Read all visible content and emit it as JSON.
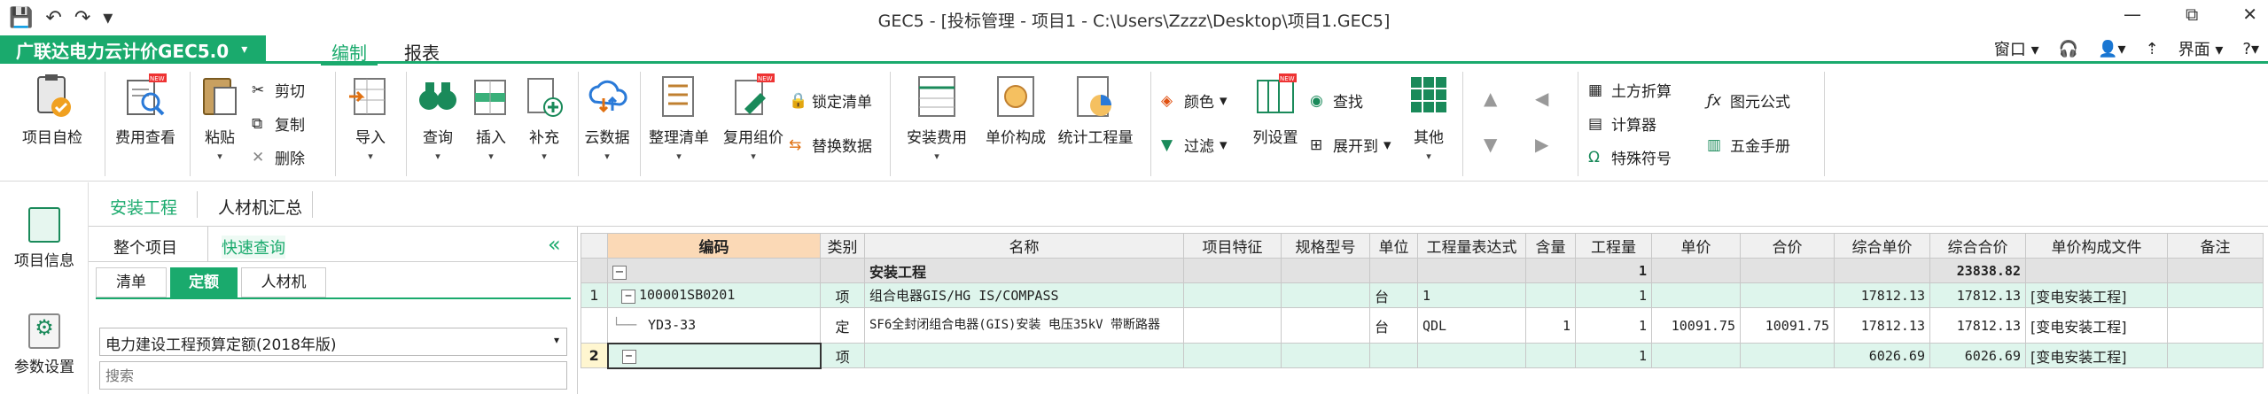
{
  "window": {
    "title": "GEC5 - [投标管理 - 项目1 - C:\\Users\\Zzzz\\Desktop\\项目1.GEC5]",
    "controls": [
      "—",
      "⧉",
      "✕"
    ]
  },
  "quick_access": {
    "save": "💾",
    "undo": "↶",
    "redo": "↷",
    "more": "▾"
  },
  "brand": {
    "label": "广联达电力云计价GEC5.0",
    "caret": "▾"
  },
  "menu_tabs": {
    "edit": "编制",
    "report": "报表"
  },
  "right_menu": {
    "window": "窗口",
    "window_caret": "▾",
    "interface": "界面",
    "interface_caret": "▾"
  },
  "ribbon": {
    "project_check": "项目自检",
    "fee_view": "费用查看",
    "paste": "粘贴",
    "cut": "剪切",
    "copy": "复制",
    "delete": "删除",
    "import": "导入",
    "query": "查询",
    "insert": "插入",
    "supplement": "补充",
    "cloud_data": "云数据",
    "organize_list": "整理清单",
    "reuse_price": "复用组价",
    "lock_list": "锁定清单",
    "replace_data": "替换数据",
    "install_fee": "安装费用",
    "unit_compose": "单价构成",
    "stat_qty": "统计工程量",
    "color": "颜色",
    "filter": "过滤",
    "col_settings": "列设置",
    "find": "查找",
    "expand_to": "展开到",
    "other": "其他",
    "earthwork": "土方折算",
    "calculator": "计算器",
    "special_symbol": "特殊符号",
    "element_formula": "图元公式",
    "hardware_manual": "五金手册",
    "new_badge": "NEW"
  },
  "left_nav": {
    "project_info": "项目信息",
    "param_settings": "参数设置"
  },
  "tabs2": {
    "install": "安装工程",
    "labor_summary": "人材机汇总"
  },
  "panel": {
    "whole_project": "整个项目",
    "quick_query": "快速查询",
    "subtabs": {
      "list": "清单",
      "quota": "定额",
      "labor": "人材机"
    },
    "quota_select": "电力建设工程预算定额(2018年版)",
    "search_placeholder": "搜索",
    "collapse": "«"
  },
  "table": {
    "headers": [
      "编码",
      "类别",
      "名称",
      "项目特征",
      "规格型号",
      "单位",
      "工程量表达式",
      "含量",
      "工程量",
      "单价",
      "合价",
      "综合单价",
      "综合合价",
      "单价构成文件",
      "备注"
    ],
    "rows": [
      {
        "idx": "",
        "toggle": "−",
        "code": "",
        "type": "",
        "name": "安装工程",
        "feature": "",
        "spec": "",
        "unit": "",
        "expr": "",
        "content": "",
        "qty": "1",
        "price": "",
        "total": "",
        "comp_price": "",
        "comp_total": "23838.82",
        "file": "",
        "note": ""
      },
      {
        "idx": "1",
        "toggle": "−",
        "code": "100001SB0201",
        "type": "项",
        "name": "组合电器GIS/HG IS/COMPASS",
        "feature": "",
        "spec": "",
        "unit": "台",
        "expr": "1",
        "content": "",
        "qty": "1",
        "price": "",
        "total": "",
        "comp_price": "17812.13",
        "comp_total": "17812.13",
        "file": "[变电安装工程]",
        "note": ""
      },
      {
        "idx": "",
        "toggle": "",
        "code": "YD3-33",
        "type": "定",
        "name": "SF6全封闭组合电器(GIS)安装 电压35kV 带断路器",
        "feature": "",
        "spec": "",
        "unit": "台",
        "expr": "QDL",
        "content": "1",
        "qty": "1",
        "price": "10091.75",
        "total": "10091.75",
        "comp_price": "17812.13",
        "comp_total": "17812.13",
        "file": "[变电安装工程]",
        "note": ""
      },
      {
        "idx": "2",
        "toggle": "−",
        "code": "",
        "type": "项",
        "name": "",
        "feature": "",
        "spec": "",
        "unit": "",
        "expr": "",
        "content": "",
        "qty": "1",
        "price": "",
        "total": "",
        "comp_price": "6026.69",
        "comp_total": "6026.69",
        "file": "[变电安装工程]",
        "note": ""
      }
    ]
  }
}
